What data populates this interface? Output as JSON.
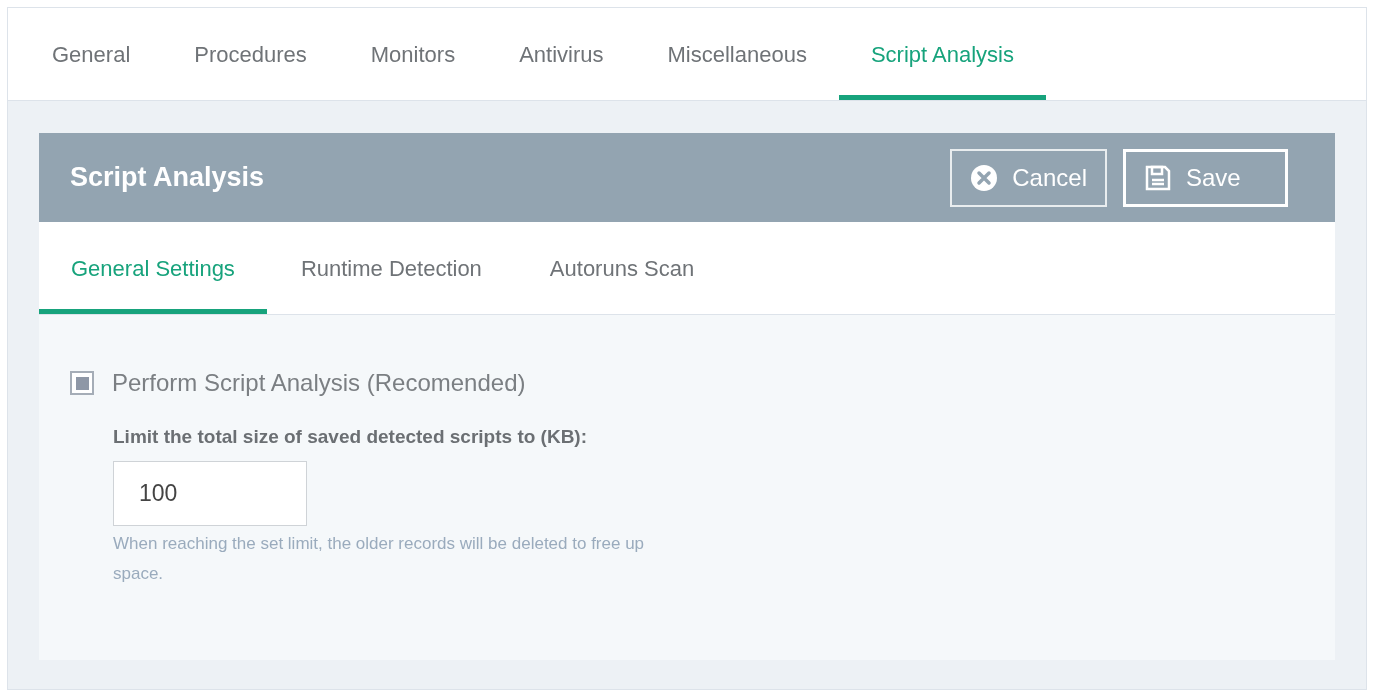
{
  "tabs": [
    {
      "label": "General",
      "selected": false
    },
    {
      "label": "Procedures",
      "selected": false
    },
    {
      "label": "Monitors",
      "selected": false
    },
    {
      "label": "Antivirus",
      "selected": false
    },
    {
      "label": "Miscellaneous",
      "selected": false
    },
    {
      "label": "Script Analysis",
      "selected": true
    }
  ],
  "panel": {
    "title": "Script Analysis",
    "buttons": [
      {
        "kind": "cancel",
        "label": "Cancel"
      },
      {
        "kind": "save",
        "label": "Save"
      }
    ]
  },
  "subtabs": [
    {
      "label": "General Settings",
      "selected": true
    },
    {
      "label": "Runtime Detection",
      "selected": false
    },
    {
      "label": "Autoruns Scan",
      "selected": false
    }
  ],
  "settings": {
    "checkbox": {
      "label": "Perform Script Analysis (Recomended)",
      "checked": true
    },
    "limit_label": "Limit the total size of saved detected scripts to (KB):",
    "limit_value": "100",
    "help": "When reaching the set limit, the older records will be deleted to free up space."
  }
}
